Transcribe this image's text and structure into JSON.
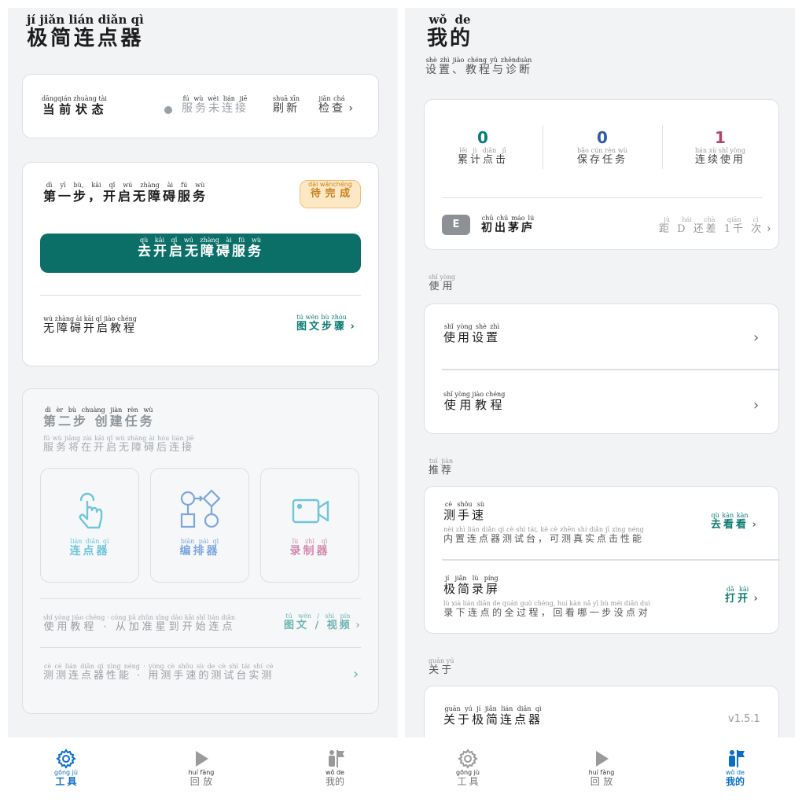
{
  "left": {
    "title": "极简连点器",
    "title_py": [
      "jí",
      "jiǎn",
      "lián",
      "diǎn",
      "qì"
    ],
    "status": {
      "label": "当前状态",
      "label_py": "dāngqián zhuàng tài",
      "text": "服务未连接",
      "text_py": "fú wù wèi lián jiē",
      "refresh": "刷新",
      "refresh_py": "shuā xīn",
      "check": "检查",
      "check_py": "jiǎn chá"
    },
    "step1": {
      "title": "第一步，开启无障碍服务",
      "title_py": "dì yī bù, kāi qǐ wú zhàng ài fú wù",
      "badge": "待完成",
      "badge_py": "dài wánchéng",
      "button": "去开启无障碍服务",
      "button_py": "qù kāi qǐ wú zhàng ài fú wù",
      "tutorial": "无障碍开启教程",
      "tutorial_py": "wú zhàng ài kāi qǐ jiào chéng",
      "tutorial_link": "图文步骤",
      "tutorial_link_py": "tú wén bù zhòu"
    },
    "step2": {
      "title": "第二步 创建任务",
      "title_py": "dì èr bù chuàng jiàn rèn wù",
      "subtitle": "服务将在开启无障碍后连接",
      "subtitle_py": "fú wù jiāng zài kāi qǐ wú zhàng ài hòu lián jiē",
      "tools": [
        {
          "name": "连点器",
          "py": "lián diǎn qì",
          "icon": "tap-hand-icon",
          "color": "#6ec5dd"
        },
        {
          "name": "编排器",
          "py": "biān pái qì",
          "icon": "flow-diagram-icon",
          "color": "#7ca7dd"
        },
        {
          "name": "录制器",
          "py": "lù zhì qì",
          "icon": "video-camera-icon",
          "color": "#d48ab0"
        }
      ],
      "row1_text": "使用教程 · 从加准星到开始连点",
      "row1_py": "shǐ yòng jiào chéng · cóng jiā zhǔn xīng dào kāi shǐ lián diǎn",
      "row1_link": "图文 / 视频",
      "row1_link_py": "tú wén / shì pín",
      "row2_text": "测测连点器性能 · 用测手速的测试台实测",
      "row2_py": "cè cè lián diǎn qì xìng néng · yòng cè shǒu sù de cè shì tái shí cè"
    },
    "tabs": [
      {
        "label": "工具",
        "py": "gōng jù",
        "icon": "gear-icon"
      },
      {
        "label": "回放",
        "py": "huí fàng",
        "icon": "play-icon"
      },
      {
        "label": "我的",
        "py": "wǒ de",
        "icon": "person-flag-icon"
      }
    ],
    "active_tab": 0
  },
  "right": {
    "title": "我的",
    "title_py": [
      "wǒ",
      "de"
    ],
    "subtitle": "设置、教程与诊断",
    "subtitle_py": "shè zhì jiào chéng yǔ zhěnduàn",
    "stats": [
      {
        "value": "0",
        "label": "累计点击",
        "py": "lěi jì diǎn jī",
        "color": "#0b7b72"
      },
      {
        "value": "0",
        "label": "保存任务",
        "py": "bǎo cún rèn wù",
        "color": "#2e5bab"
      },
      {
        "value": "1",
        "label": "连续使用",
        "py": "lián xù shǐ yòng",
        "color": "#b0476e"
      }
    ],
    "level": {
      "badge": "E",
      "name": "初出茅庐",
      "name_py": "chū chū máo lú",
      "next": "距 D 还差 1千 次",
      "next_py": "jù hái chà qiān cì"
    },
    "use_section": {
      "label": "使用",
      "py": "shǐ yòng"
    },
    "use_items": [
      {
        "label": "使用设置",
        "py": "shǐ yòng shè zhì"
      },
      {
        "label": "使用教程",
        "py": "shǐ yòng jiào chéng"
      }
    ],
    "rec_section": {
      "label": "推荐",
      "py": "tuī jiàn"
    },
    "rec_items": [
      {
        "title": "测手速",
        "title_py": "cè shǒu sù",
        "desc": "内置连点器测试台，可测真实点击性能",
        "desc_py": "nèi zhì lián diǎn qì cè shì tái, kě cè zhēn shí diǎn jī xìng néng",
        "action": "去看看",
        "action_py": "qù kàn kàn"
      },
      {
        "title": "极简录屏",
        "title_py": "jí jiǎn lù píng",
        "desc": "录下连点的全过程，回看哪一步没点对",
        "desc_py": "lù xià lián diǎn de quán guò chéng, huí kàn nǎ yī bù méi diǎn duì",
        "action": "打开",
        "action_py": "dǎ kāi"
      }
    ],
    "about_section": {
      "label": "关于",
      "py": "guān yú"
    },
    "about": {
      "label": "关于极简连点器",
      "py": "guān yú jí jiǎn lián diǎn qì",
      "version": "v1.5.1"
    },
    "tabs": [
      {
        "label": "工具",
        "py": "gōng jù",
        "icon": "gear-icon"
      },
      {
        "label": "回放",
        "py": "huí fàng",
        "icon": "play-icon"
      },
      {
        "label": "我的",
        "py": "wǒ de",
        "icon": "person-flag-icon"
      }
    ],
    "active_tab": 2
  },
  "colors": {
    "accent": "#0b6f68",
    "tab_active": "#0b6fc6",
    "badge_bg": "#fde8c5",
    "badge_text": "#c9801b"
  }
}
